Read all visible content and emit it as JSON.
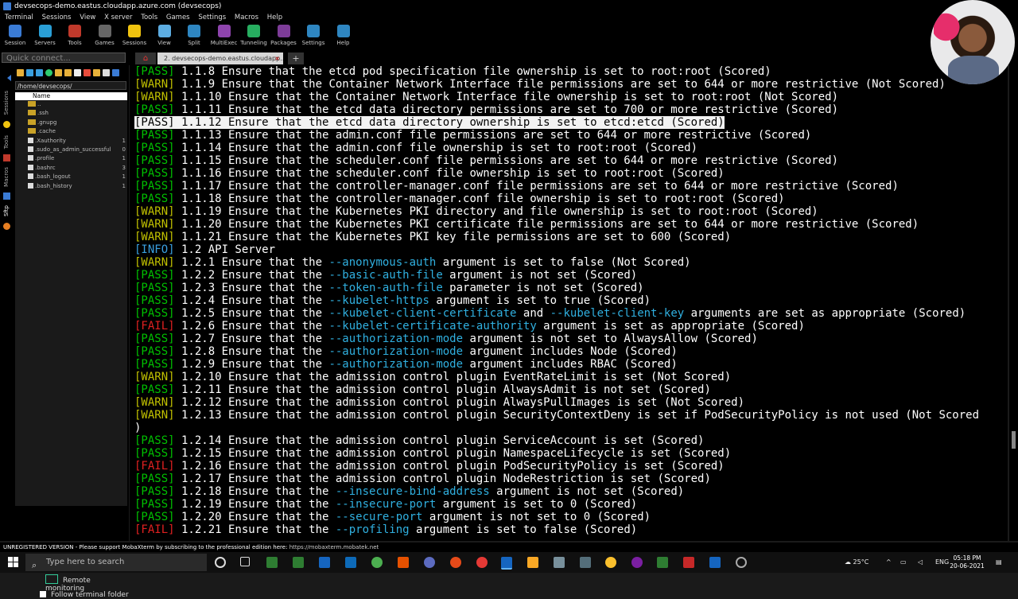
{
  "window": {
    "title": "devsecops-demo.eastus.cloudapp.azure.com (devsecops)"
  },
  "menu": [
    "Terminal",
    "Sessions",
    "View",
    "X server",
    "Tools",
    "Games",
    "Settings",
    "Macros",
    "Help"
  ],
  "toolbar": [
    {
      "label": "Session",
      "icon": "session-icon",
      "color": "#3a7bd5"
    },
    {
      "label": "Servers",
      "icon": "servers-icon",
      "color": "#2a9fd6"
    },
    {
      "label": "Tools",
      "icon": "tools-icon",
      "color": "#c0392b"
    },
    {
      "label": "Games",
      "icon": "games-icon",
      "color": "#666"
    },
    {
      "label": "Sessions",
      "icon": "star-icon",
      "color": "#f1c40f"
    },
    {
      "label": "View",
      "icon": "view-icon",
      "color": "#5dade2"
    },
    {
      "label": "Split",
      "icon": "split-icon",
      "color": "#2e86c1"
    },
    {
      "label": "MultiExec",
      "icon": "multiexec-icon",
      "color": "#8e44ad"
    },
    {
      "label": "Tunneling",
      "icon": "tunneling-icon",
      "color": "#27ae60"
    },
    {
      "label": "Packages",
      "icon": "packages-icon",
      "color": "#7d3c98"
    },
    {
      "label": "Settings",
      "icon": "settings-icon",
      "color": "#2e86c1"
    },
    {
      "label": "Help",
      "icon": "help-icon",
      "color": "#2e86c1"
    }
  ],
  "quick_connect": {
    "placeholder": "Quick connect..."
  },
  "tabs": {
    "session_tab": "2. devsecops-demo.eastus.cloudapp..."
  },
  "sidebar": {
    "vertical_tabs": [
      "Sessions",
      "Tools",
      "Macros",
      "Sftp"
    ],
    "path": "/home/devsecops/",
    "column_name": "Name",
    "files": [
      {
        "name": "..",
        "size": ""
      },
      {
        "name": ".ssh",
        "size": ""
      },
      {
        "name": ".gnupg",
        "size": ""
      },
      {
        "name": ".cache",
        "size": ""
      },
      {
        "name": ".Xauthority",
        "size": "1"
      },
      {
        "name": ".sudo_as_admin_successful",
        "size": "0"
      },
      {
        "name": ".profile",
        "size": "1"
      },
      {
        "name": ".bashrc",
        "size": "3"
      },
      {
        "name": ".bash_logout",
        "size": "1"
      },
      {
        "name": ".bash_history",
        "size": "1"
      }
    ],
    "remote_monitoring": "Remote monitoring",
    "follow_terminal_folder": "Follow terminal folder"
  },
  "terminal": {
    "lines": [
      {
        "status": "[PASS]",
        "level": "pass",
        "segments": [
          {
            "t": " 1.1.8 Ensure that the etcd pod specification file ownership is set to root:root (Scored)",
            "hl": false
          }
        ]
      },
      {
        "status": "[WARN]",
        "level": "warn",
        "segments": [
          {
            "t": " 1.1.9 Ensure that the Container Network Interface file permissions are set to 644 or more restrictive (Not Scored)",
            "hl": false
          }
        ]
      },
      {
        "status": "[WARN]",
        "level": "warn",
        "segments": [
          {
            "t": " 1.1.10 Ensure that the Container Network Interface file ownership is set to root:root (Not Scored)",
            "hl": false
          }
        ]
      },
      {
        "status": "[PASS]",
        "level": "pass",
        "segments": [
          {
            "t": " 1.1.11 Ensure that the etcd data directory permissions are set to 700 or more restrictive (Scored)",
            "hl": false
          }
        ]
      },
      {
        "status": "[PASS]",
        "level": "pass",
        "selected": true,
        "segments": [
          {
            "t": " 1.1.12 Ensure that the etcd data directory ownership is set to etcd:etcd (Scored)",
            "hl": false
          }
        ]
      },
      {
        "status": "[PASS]",
        "level": "pass",
        "segments": [
          {
            "t": " 1.1.13 Ensure that the admin.conf file permissions are set to 644 or more restrictive (Scored)",
            "hl": false
          }
        ]
      },
      {
        "status": "[PASS]",
        "level": "pass",
        "segments": [
          {
            "t": " 1.1.14 Ensure that the admin.conf file ownership is set to root:root (Scored)",
            "hl": false
          }
        ]
      },
      {
        "status": "[PASS]",
        "level": "pass",
        "segments": [
          {
            "t": " 1.1.15 Ensure that the scheduler.conf file permissions are set to 644 or more restrictive (Scored)",
            "hl": false
          }
        ]
      },
      {
        "status": "[PASS]",
        "level": "pass",
        "segments": [
          {
            "t": " 1.1.16 Ensure that the scheduler.conf file ownership is set to root:root (Scored)",
            "hl": false
          }
        ]
      },
      {
        "status": "[PASS]",
        "level": "pass",
        "segments": [
          {
            "t": " 1.1.17 Ensure that the controller-manager.conf file permissions are set to 644 or more restrictive (Scored)",
            "hl": false
          }
        ]
      },
      {
        "status": "[PASS]",
        "level": "pass",
        "segments": [
          {
            "t": " 1.1.18 Ensure that the controller-manager.conf file ownership is set to root:root (Scored)",
            "hl": false
          }
        ]
      },
      {
        "status": "[WARN]",
        "level": "warn",
        "segments": [
          {
            "t": " 1.1.19 Ensure that the Kubernetes PKI directory and file ownership is set to root:root (Scored)",
            "hl": false
          }
        ]
      },
      {
        "status": "[WARN]",
        "level": "warn",
        "segments": [
          {
            "t": " 1.1.20 Ensure that the Kubernetes PKI certificate file permissions are set to 644 or more restrictive (Scored)",
            "hl": false
          }
        ]
      },
      {
        "status": "[WARN]",
        "level": "warn",
        "segments": [
          {
            "t": " 1.1.21 Ensure that the Kubernetes PKI key file permissions are set to 600 (Scored)",
            "hl": false
          }
        ]
      },
      {
        "status": "[INFO]",
        "level": "info",
        "segments": [
          {
            "t": " 1.2 API Server",
            "hl": false
          }
        ]
      },
      {
        "status": "[WARN]",
        "level": "warn",
        "segments": [
          {
            "t": " 1.2.1 Ensure that the ",
            "hl": false
          },
          {
            "t": "--anonymous-auth",
            "hl": true
          },
          {
            "t": " argument is set to false (Not Scored)",
            "hl": false
          }
        ]
      },
      {
        "status": "[PASS]",
        "level": "pass",
        "segments": [
          {
            "t": " 1.2.2 Ensure that the ",
            "hl": false
          },
          {
            "t": "--basic-auth-file",
            "hl": true
          },
          {
            "t": " argument is not set (Scored)",
            "hl": false
          }
        ]
      },
      {
        "status": "[PASS]",
        "level": "pass",
        "segments": [
          {
            "t": " 1.2.3 Ensure that the ",
            "hl": false
          },
          {
            "t": "--token-auth-file",
            "hl": true
          },
          {
            "t": " parameter is not set (Scored)",
            "hl": false
          }
        ]
      },
      {
        "status": "[PASS]",
        "level": "pass",
        "segments": [
          {
            "t": " 1.2.4 Ensure that the ",
            "hl": false
          },
          {
            "t": "--kubelet-https",
            "hl": true
          },
          {
            "t": " argument is set to true (Scored)",
            "hl": false
          }
        ]
      },
      {
        "status": "[PASS]",
        "level": "pass",
        "segments": [
          {
            "t": " 1.2.5 Ensure that the ",
            "hl": false
          },
          {
            "t": "--kubelet-client-certificate",
            "hl": true
          },
          {
            "t": " and ",
            "hl": false
          },
          {
            "t": "--kubelet-client-key",
            "hl": true
          },
          {
            "t": " arguments are set as appropriate (Scored)",
            "hl": false
          }
        ]
      },
      {
        "status": "[FAIL]",
        "level": "fail",
        "segments": [
          {
            "t": " 1.2.6 Ensure that the ",
            "hl": false
          },
          {
            "t": "--kubelet-certificate-authority",
            "hl": true
          },
          {
            "t": " argument is set as appropriate (Scored)",
            "hl": false
          }
        ]
      },
      {
        "status": "[PASS]",
        "level": "pass",
        "segments": [
          {
            "t": " 1.2.7 Ensure that the ",
            "hl": false
          },
          {
            "t": "--authorization-mode",
            "hl": true
          },
          {
            "t": " argument is not set to AlwaysAllow (Scored)",
            "hl": false
          }
        ]
      },
      {
        "status": "[PASS]",
        "level": "pass",
        "segments": [
          {
            "t": " 1.2.8 Ensure that the ",
            "hl": false
          },
          {
            "t": "--authorization-mode",
            "hl": true
          },
          {
            "t": " argument includes Node (Scored)",
            "hl": false
          }
        ]
      },
      {
        "status": "[PASS]",
        "level": "pass",
        "segments": [
          {
            "t": " 1.2.9 Ensure that the ",
            "hl": false
          },
          {
            "t": "--authorization-mode",
            "hl": true
          },
          {
            "t": " argument includes RBAC (Scored)",
            "hl": false
          }
        ]
      },
      {
        "status": "[WARN]",
        "level": "warn",
        "segments": [
          {
            "t": " 1.2.10 Ensure that the admission control plugin EventRateLimit is set (Not Scored)",
            "hl": false
          }
        ]
      },
      {
        "status": "[PASS]",
        "level": "pass",
        "segments": [
          {
            "t": " 1.2.11 Ensure that the admission control plugin AlwaysAdmit is not set (Scored)",
            "hl": false
          }
        ]
      },
      {
        "status": "[WARN]",
        "level": "warn",
        "segments": [
          {
            "t": " 1.2.12 Ensure that the admission control plugin AlwaysPullImages is set (Not Scored)",
            "hl": false
          }
        ]
      },
      {
        "status": "[WARN]",
        "level": "warn",
        "segments": [
          {
            "t": " 1.2.13 Ensure that the admission control plugin SecurityContextDeny is set if PodSecurityPolicy is not used (Not Scored",
            "hl": false
          }
        ]
      },
      {
        "status": "",
        "level": "none",
        "segments": [
          {
            "t": ")",
            "hl": false
          }
        ]
      },
      {
        "status": "[PASS]",
        "level": "pass",
        "segments": [
          {
            "t": " 1.2.14 Ensure that the admission control plugin ServiceAccount is set (Scored)",
            "hl": false
          }
        ]
      },
      {
        "status": "[PASS]",
        "level": "pass",
        "segments": [
          {
            "t": " 1.2.15 Ensure that the admission control plugin NamespaceLifecycle is set (Scored)",
            "hl": false
          }
        ]
      },
      {
        "status": "[FAIL]",
        "level": "fail",
        "segments": [
          {
            "t": " 1.2.16 Ensure that the admission control plugin PodSecurityPolicy is set (Scored)",
            "hl": false
          }
        ]
      },
      {
        "status": "[PASS]",
        "level": "pass",
        "segments": [
          {
            "t": " 1.2.17 Ensure that the admission control plugin NodeRestriction is set (Scored)",
            "hl": false
          }
        ]
      },
      {
        "status": "[PASS]",
        "level": "pass",
        "segments": [
          {
            "t": " 1.2.18 Ensure that the ",
            "hl": false
          },
          {
            "t": "--insecure-bind-address",
            "hl": true
          },
          {
            "t": " argument is not set (Scored)",
            "hl": false
          }
        ]
      },
      {
        "status": "[PASS]",
        "level": "pass",
        "segments": [
          {
            "t": " 1.2.19 Ensure that the ",
            "hl": false
          },
          {
            "t": "--insecure-port",
            "hl": true
          },
          {
            "t": " argument is set to 0 (Scored)",
            "hl": false
          }
        ]
      },
      {
        "status": "[PASS]",
        "level": "pass",
        "segments": [
          {
            "t": " 1.2.20 Ensure that the ",
            "hl": false
          },
          {
            "t": "--secure-port",
            "hl": true
          },
          {
            "t": " argument is not set to 0 (Scored)",
            "hl": false
          }
        ]
      },
      {
        "status": "[FAIL]",
        "level": "fail",
        "segments": [
          {
            "t": " 1.2.21 Ensure that the ",
            "hl": false
          },
          {
            "t": "--profiling",
            "hl": true
          },
          {
            "t": " argument is set to false (Scored)",
            "hl": false
          }
        ]
      }
    ]
  },
  "statusbar": {
    "text": "UNREGISTERED VERSION  -  Please support MobaXterm by subscribing to the professional edition here:",
    "url": "https://mobaxterm.mobatek.net"
  },
  "taskbar": {
    "search_placeholder": "Type here to search",
    "weather": "25°C",
    "language": "ENG",
    "time": "05:18 PM",
    "date": "20-06-2021"
  },
  "colors": {
    "pass": "#00c000",
    "warn": "#c0c000",
    "fail": "#e02020",
    "info": "#3aa0e0",
    "flag": "#30b0e0"
  }
}
